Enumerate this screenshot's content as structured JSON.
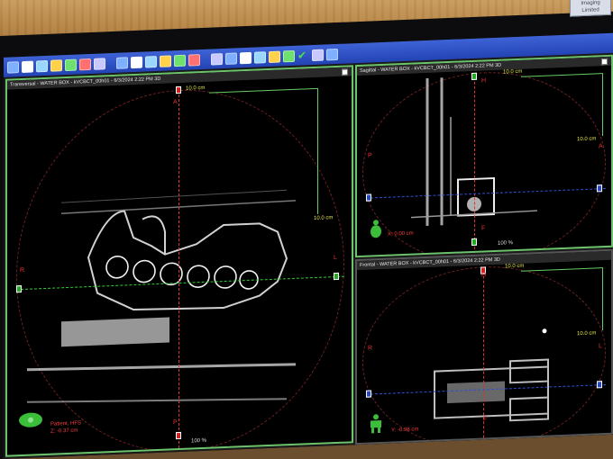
{
  "badge": {
    "line1": "Imaging",
    "line2": "Limited"
  },
  "viewports": {
    "transversal": {
      "title": "Transversal - WATER BOX - kVCBCT_00h01 - 6/3/2024 2:22 PM 3D",
      "scale_top": "10.0 cm",
      "scale_right": "10.0 cm",
      "dir_top": "A",
      "dir_bottom": "P",
      "dir_left": "R",
      "dir_right": "L",
      "patient_label": "Patient, HFS",
      "coord": "Z: -0.37 cm",
      "zoom": "100 %"
    },
    "sagittal": {
      "title": "Sagittal - WATER BOX - kVCBCT_00h01 - 6/3/2024 2:22 PM 3D",
      "scale_top": "10.0 cm",
      "scale_right": "10.0 cm",
      "dir_top": "H",
      "dir_left": "P",
      "dir_right": "A",
      "dir_bottom": "F",
      "coord": "X: 0.00 cm",
      "zoom": "100 %"
    },
    "frontal": {
      "title": "Frontal - WATER BOX - kVCBCT_00h01 - 6/3/2024 2:22 PM 3D",
      "scale_top": "10.0 cm",
      "scale_right": "10.0 cm",
      "dir_top": "H",
      "dir_left": "R",
      "dir_right": "L",
      "dir_bottom": "F",
      "coord": "Y: -0.98 cm",
      "zoom": "100 %"
    }
  },
  "colors": {
    "border_active": "#6cc36c",
    "crosshair_red": "#dd3333",
    "crosshair_green": "#33cc33",
    "crosshair_blue": "#3050d0",
    "scale_text": "#e8e850",
    "coord_text": "#ff4040",
    "toolbar": "#2a4cc0"
  },
  "toolbar_icons": [
    "window-level-icon",
    "layout-icon",
    "zoom-in-icon",
    "zoom-out-icon",
    "pan-hand-icon",
    "undo-icon",
    "measure-ruler-icon",
    "crosshair-move-icon",
    "color-map-icon",
    "grid-icon",
    "info-icon",
    "contour-icon",
    "structure-icon",
    "rectangle-select-icon",
    "lasso-icon",
    "overlay-icon",
    "dose-icon",
    "window-icon",
    "marker-icon",
    "accept-check-icon",
    "lock-icon",
    "wave-icon"
  ]
}
